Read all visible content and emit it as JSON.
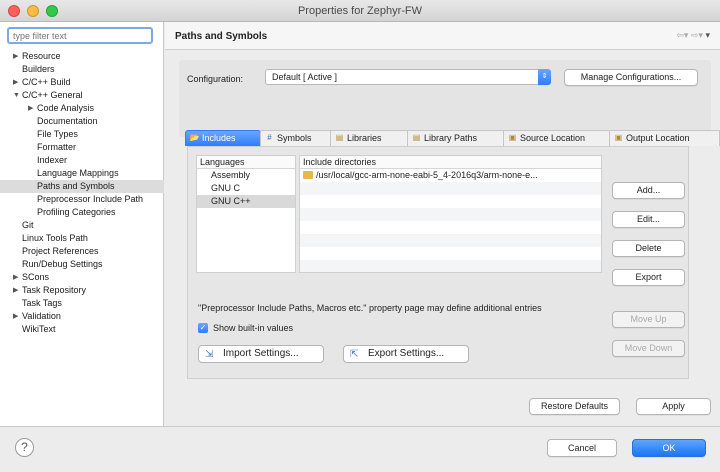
{
  "window": {
    "title": "Properties for Zephyr-FW"
  },
  "filter": {
    "placeholder": "type filter text"
  },
  "tree": [
    {
      "label": "Resource",
      "level": 0,
      "twisty": "right"
    },
    {
      "label": "Builders",
      "level": 0,
      "twisty": ""
    },
    {
      "label": "C/C++ Build",
      "level": 0,
      "twisty": "right"
    },
    {
      "label": "C/C++ General",
      "level": 0,
      "twisty": "down"
    },
    {
      "label": "Code Analysis",
      "level": 1,
      "twisty": "right"
    },
    {
      "label": "Documentation",
      "level": 1,
      "twisty": ""
    },
    {
      "label": "File Types",
      "level": 1,
      "twisty": ""
    },
    {
      "label": "Formatter",
      "level": 1,
      "twisty": ""
    },
    {
      "label": "Indexer",
      "level": 1,
      "twisty": ""
    },
    {
      "label": "Language Mappings",
      "level": 1,
      "twisty": ""
    },
    {
      "label": "Paths and Symbols",
      "level": 1,
      "twisty": "",
      "selected": true
    },
    {
      "label": "Preprocessor Include Path",
      "level": 1,
      "twisty": ""
    },
    {
      "label": "Profiling Categories",
      "level": 1,
      "twisty": ""
    },
    {
      "label": "Git",
      "level": 0,
      "twisty": ""
    },
    {
      "label": "Linux Tools Path",
      "level": 0,
      "twisty": ""
    },
    {
      "label": "Project References",
      "level": 0,
      "twisty": ""
    },
    {
      "label": "Run/Debug Settings",
      "level": 0,
      "twisty": ""
    },
    {
      "label": "SCons",
      "level": 0,
      "twisty": "right"
    },
    {
      "label": "Task Repository",
      "level": 0,
      "twisty": "right"
    },
    {
      "label": "Task Tags",
      "level": 0,
      "twisty": ""
    },
    {
      "label": "Validation",
      "level": 0,
      "twisty": "right"
    },
    {
      "label": "WikiText",
      "level": 0,
      "twisty": ""
    }
  ],
  "page": {
    "title": "Paths and Symbols"
  },
  "config": {
    "label": "Configuration:",
    "value": "Default  [ Active ]",
    "manage_label": "Manage Configurations..."
  },
  "tabs": [
    {
      "label": "Includes",
      "icon": "includes-icon",
      "active": true
    },
    {
      "label": "Symbols",
      "icon": "symbols-icon",
      "active": false
    },
    {
      "label": "Libraries",
      "icon": "libraries-icon",
      "active": false
    },
    {
      "label": "Library Paths",
      "icon": "library-paths-icon",
      "active": false
    },
    {
      "label": "Source Location",
      "icon": "source-location-icon",
      "active": false
    },
    {
      "label": "Output Location",
      "icon": "output-location-icon",
      "active": false
    }
  ],
  "languages": {
    "header": "Languages",
    "items": [
      {
        "label": "Assembly",
        "selected": false
      },
      {
        "label": "GNU C",
        "selected": false
      },
      {
        "label": "GNU C++",
        "selected": true
      }
    ]
  },
  "includes": {
    "header": "Include directories",
    "rows": [
      "/usr/local/gcc-arm-none-eabi-5_4-2016q3/arm-none-e..."
    ]
  },
  "side_buttons": {
    "add": "Add...",
    "edit": "Edit...",
    "delete": "Delete",
    "export": "Export",
    "move_up": "Move Up",
    "move_down": "Move Down"
  },
  "note": "\"Preprocessor Include Paths, Macros etc.\" property page may define additional entries",
  "show_builtin": {
    "label": "Show built-in values",
    "checked": true
  },
  "import_settings": "Import Settings...",
  "export_settings": "Export Settings...",
  "restore_defaults": "Restore Defaults",
  "apply": "Apply",
  "cancel": "Cancel",
  "ok": "OK",
  "help": "?",
  "colors": {
    "accent": "#2f7dfa",
    "folder": "#e8b74a"
  }
}
